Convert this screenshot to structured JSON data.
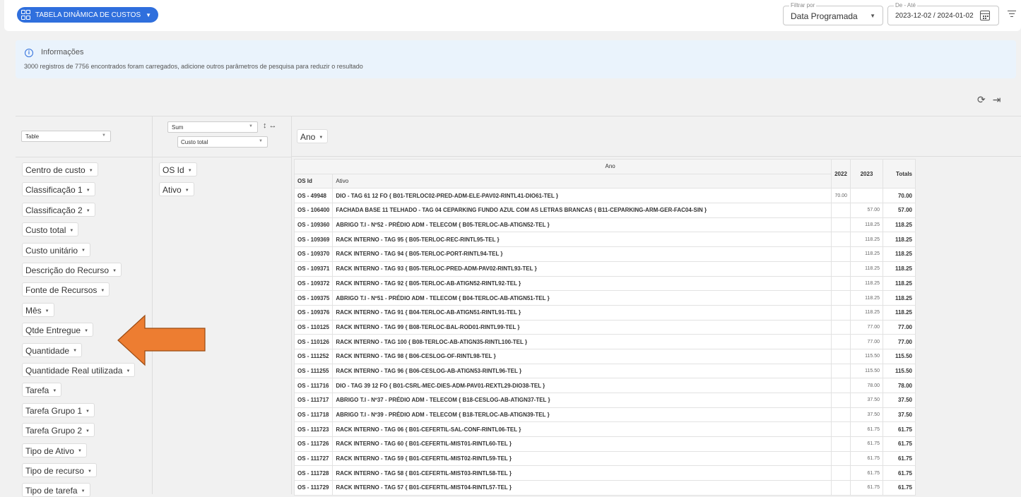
{
  "topbar": {
    "dynamic_table_label": "TABELA DINÂMICA DE CUSTOS",
    "filter_by": {
      "label": "Filtrar por",
      "value": "Data Programada"
    },
    "date_range": {
      "label": "De - Até",
      "value": "2023-12-02 / 2024-01-02"
    }
  },
  "info": {
    "title": "Informações",
    "message": "3000 registros de 7756 encontrados foram carregados, adicione outros parâmetros de pesquisa para reduzir o resultado"
  },
  "pivot": {
    "renderer": "Table",
    "aggregator": "Sum",
    "aggregator_field": "Custo total",
    "col_attr": "Ano",
    "row_attrs": [
      "OS Id",
      "Ativo"
    ],
    "unused_attrs": [
      "Centro de custo",
      "Classificação 1",
      "Classificação 2",
      "Custo total",
      "Custo unitário",
      "Descrição do Recurso",
      "Fonte de Recursos",
      "Mês",
      "Qtde Entregue",
      "Quantidade",
      "Quantidade Real utilizada",
      "Tarefa",
      "Tarefa Grupo 1",
      "Tarefa Grupo 2",
      "Tipo de Ativo",
      "Tipo de recurso",
      "Tipo de tarefa"
    ]
  },
  "table": {
    "col_header": "Ano",
    "row_headers": [
      "OS Id",
      "Ativo"
    ],
    "years": [
      "2022",
      "2023"
    ],
    "totals_label": "Totals",
    "rows": [
      {
        "os": "OS - 49948",
        "ativo": "DIO - TAG 61 12 FO { B01-TERLOC02-PRED-ADM-ELE-PAV02-RINTL41-DIO61-TEL }",
        "y2022": "70.00",
        "y2023": "",
        "total": "70.00"
      },
      {
        "os": "OS - 106400",
        "ativo": "FACHADA BASE 11 TELHADO - TAG 04 CEPARKING FUNDO AZUL COM AS LETRAS BRANCAS { B11-CEPARKING-ARM-GER-FAC04-SIN }",
        "y2022": "",
        "y2023": "57.00",
        "total": "57.00"
      },
      {
        "os": "OS - 109360",
        "ativo": "ABRIGO T.I - Nº52 - PRÉDIO ADM - TELECOM { B05-TERLOC-AB-ATIGN52-TEL }",
        "y2022": "",
        "y2023": "118.25",
        "total": "118.25"
      },
      {
        "os": "OS - 109369",
        "ativo": "RACK INTERNO - TAG 95 { B05-TERLOC-REC-RINTL95-TEL }",
        "y2022": "",
        "y2023": "118.25",
        "total": "118.25"
      },
      {
        "os": "OS - 109370",
        "ativo": "RACK INTERNO - TAG 94 { B05-TERLOC-PORT-RINTL94-TEL }",
        "y2022": "",
        "y2023": "118.25",
        "total": "118.25"
      },
      {
        "os": "OS - 109371",
        "ativo": "RACK INTERNO - TAG 93 { B05-TERLOC-PRED-ADM-PAV02-RINTL93-TEL }",
        "y2022": "",
        "y2023": "118.25",
        "total": "118.25"
      },
      {
        "os": "OS - 109372",
        "ativo": "RACK INTERNO - TAG 92 { B05-TERLOC-AB-ATIGN52-RINTL92-TEL }",
        "y2022": "",
        "y2023": "118.25",
        "total": "118.25"
      },
      {
        "os": "OS - 109375",
        "ativo": "ABRIGO T.I - Nº51 - PRÉDIO ADM - TELECOM { B04-TERLOC-AB-ATIGN51-TEL }",
        "y2022": "",
        "y2023": "118.25",
        "total": "118.25"
      },
      {
        "os": "OS - 109376",
        "ativo": "RACK INTERNO - TAG 91 { B04-TERLOC-AB-ATIGN51-RINTL91-TEL }",
        "y2022": "",
        "y2023": "118.25",
        "total": "118.25"
      },
      {
        "os": "OS - 110125",
        "ativo": "RACK INTERNO - TAG 99 { B08-TERLOC-BAL-ROD01-RINTL99-TEL }",
        "y2022": "",
        "y2023": "77.00",
        "total": "77.00"
      },
      {
        "os": "OS - 110126",
        "ativo": "RACK INTERNO - TAG 100 { B08-TERLOC-AB-ATIGN35-RINTL100-TEL }",
        "y2022": "",
        "y2023": "77.00",
        "total": "77.00"
      },
      {
        "os": "OS - 111252",
        "ativo": "RACK INTERNO - TAG 98 { B06-CESLOG-OF-RINTL98-TEL }",
        "y2022": "",
        "y2023": "115.50",
        "total": "115.50"
      },
      {
        "os": "OS - 111255",
        "ativo": "RACK INTERNO - TAG 96 { B06-CESLOG-AB-ATIGN53-RINTL96-TEL }",
        "y2022": "",
        "y2023": "115.50",
        "total": "115.50"
      },
      {
        "os": "OS - 111716",
        "ativo": "DIO - TAG 39 12 FO { B01-CSRL-MEC-DIES-ADM-PAV01-REXTL29-DIO38-TEL }",
        "y2022": "",
        "y2023": "78.00",
        "total": "78.00"
      },
      {
        "os": "OS - 111717",
        "ativo": "ABRIGO T.I - Nº37 - PRÉDIO ADM - TELECOM { B18-CESLOG-AB-ATIGN37-TEL }",
        "y2022": "",
        "y2023": "37.50",
        "total": "37.50"
      },
      {
        "os": "OS - 111718",
        "ativo": "ABRIGO T.I - Nº39 - PRÉDIO ADM - TELECOM { B18-TERLOC-AB-ATIGN39-TEL }",
        "y2022": "",
        "y2023": "37.50",
        "total": "37.50"
      },
      {
        "os": "OS - 111723",
        "ativo": "RACK INTERNO - TAG 06 { B01-CEFERTIL-SAL-CONF-RINTL06-TEL }",
        "y2022": "",
        "y2023": "61.75",
        "total": "61.75"
      },
      {
        "os": "OS - 111726",
        "ativo": "RACK INTERNO - TAG 60 { B01-CEFERTIL-MIST01-RINTL60-TEL }",
        "y2022": "",
        "y2023": "61.75",
        "total": "61.75"
      },
      {
        "os": "OS - 111727",
        "ativo": "RACK INTERNO - TAG 59 { B01-CEFERTIL-MIST02-RINTL59-TEL }",
        "y2022": "",
        "y2023": "61.75",
        "total": "61.75"
      },
      {
        "os": "OS - 111728",
        "ativo": "RACK INTERNO - TAG 58 { B01-CEFERTIL-MIST03-RINTL58-TEL }",
        "y2022": "",
        "y2023": "61.75",
        "total": "61.75"
      },
      {
        "os": "OS - 111729",
        "ativo": "RACK INTERNO - TAG 57 { B01-CEFERTIL-MIST04-RINTL57-TEL }",
        "y2022": "",
        "y2023": "61.75",
        "total": "61.75"
      }
    ]
  },
  "colors": {
    "primary": "#2f6fdd",
    "info_bg": "#eaf3fc",
    "arrow": "#ed7d31"
  }
}
